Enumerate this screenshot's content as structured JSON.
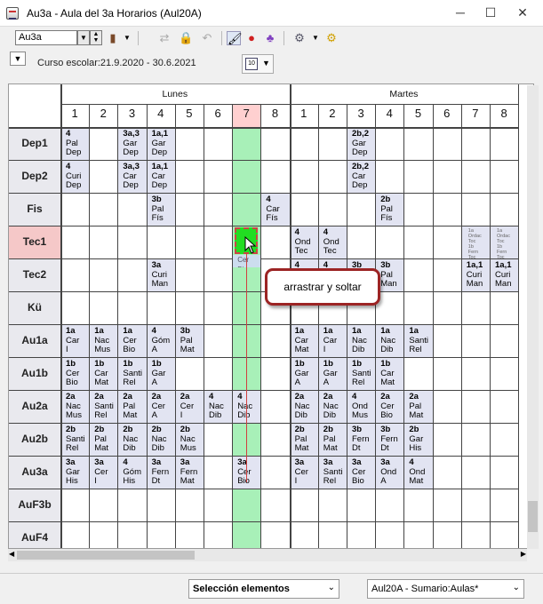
{
  "window": {
    "title": "Au3a - Aula del 3a  Horarios  (Aul20A)",
    "minimize": "─",
    "maximize": "☐",
    "close": "✕"
  },
  "toolbar": {
    "room_combo": "Au3a"
  },
  "subbar": {
    "curso": "Curso escolar:21.9.2020 - 30.6.2021",
    "cal_icon": "10"
  },
  "grid": {
    "days": [
      "Lunes",
      "Martes"
    ],
    "periods": [
      "1",
      "2",
      "3",
      "4",
      "5",
      "6",
      "7",
      "8",
      "1",
      "2",
      "3",
      "4",
      "5",
      "6",
      "7",
      "8"
    ],
    "rows": [
      "Dep1",
      "Dep2",
      "Fis",
      "Tec1",
      "Tec2",
      "Kü",
      "Au1a",
      "Au1b",
      "Au2a",
      "Au2b",
      "Au3a",
      "AuF3b",
      "AuF4"
    ],
    "lessons": [
      {
        "r": 0,
        "c": 0,
        "t": [
          "4",
          "Pal",
          "Dep"
        ]
      },
      {
        "r": 0,
        "c": 2,
        "t": [
          "3a,3",
          "Gar",
          "Dep"
        ]
      },
      {
        "r": 0,
        "c": 3,
        "t": [
          "1a,1",
          "Gar",
          "Dep"
        ]
      },
      {
        "r": 0,
        "c": 10,
        "t": [
          "2b,2",
          "Gar",
          "Dep"
        ]
      },
      {
        "r": 1,
        "c": 0,
        "t": [
          "4",
          "Curi",
          "Dep"
        ]
      },
      {
        "r": 1,
        "c": 2,
        "t": [
          "3a,3",
          "Car",
          "Dep"
        ]
      },
      {
        "r": 1,
        "c": 3,
        "t": [
          "1a,1",
          "Car",
          "Dep"
        ]
      },
      {
        "r": 1,
        "c": 10,
        "t": [
          "2b,2",
          "Car",
          "Dep"
        ]
      },
      {
        "r": 2,
        "c": 3,
        "t": [
          "3b",
          "Pal",
          "Fís"
        ]
      },
      {
        "r": 2,
        "c": 7,
        "t": [
          "4",
          "Car",
          "Fís"
        ]
      },
      {
        "r": 2,
        "c": 11,
        "t": [
          "2b",
          "Pal",
          "Fís"
        ]
      },
      {
        "r": 3,
        "c": 8,
        "t": [
          "4",
          "Ond",
          "Tec"
        ]
      },
      {
        "r": 3,
        "c": 9,
        "t": [
          "4",
          "Ond",
          "Tec"
        ]
      },
      {
        "r": 4,
        "c": 3,
        "t": [
          "3a",
          "Curi",
          "Man"
        ]
      },
      {
        "r": 4,
        "c": 8,
        "t": [
          "4",
          "",
          ""
        ]
      },
      {
        "r": 4,
        "c": 9,
        "t": [
          "4",
          "",
          ""
        ]
      },
      {
        "r": 4,
        "c": 10,
        "t": [
          "3b",
          "",
          ""
        ]
      },
      {
        "r": 4,
        "c": 11,
        "t": [
          "3b",
          "Pal",
          "Man"
        ]
      },
      {
        "r": 4,
        "c": 14,
        "t": [
          "1a,1",
          "Curi",
          "Man"
        ]
      },
      {
        "r": 4,
        "c": 15,
        "t": [
          "1a,1",
          "Curi",
          "Man"
        ]
      },
      {
        "r": 6,
        "c": 0,
        "t": [
          "1a",
          "Car",
          "I"
        ]
      },
      {
        "r": 6,
        "c": 1,
        "t": [
          "1a",
          "Nac",
          "Mus"
        ]
      },
      {
        "r": 6,
        "c": 2,
        "t": [
          "1a",
          "Cer",
          "Bio"
        ]
      },
      {
        "r": 6,
        "c": 3,
        "t": [
          "4",
          "Góm",
          "A"
        ]
      },
      {
        "r": 6,
        "c": 4,
        "t": [
          "3b",
          "Pal",
          "Mat"
        ]
      },
      {
        "r": 6,
        "c": 8,
        "t": [
          "1a",
          "Car",
          "Mat"
        ]
      },
      {
        "r": 6,
        "c": 9,
        "t": [
          "1a",
          "Car",
          "I"
        ]
      },
      {
        "r": 6,
        "c": 10,
        "t": [
          "1a",
          "Nac",
          "Dib"
        ]
      },
      {
        "r": 6,
        "c": 11,
        "t": [
          "1a",
          "Nac",
          "Dib"
        ]
      },
      {
        "r": 6,
        "c": 12,
        "t": [
          "1a",
          "Santi",
          "Rel"
        ]
      },
      {
        "r": 7,
        "c": 0,
        "t": [
          "1b",
          "Cer",
          "Bio"
        ]
      },
      {
        "r": 7,
        "c": 1,
        "t": [
          "1b",
          "Car",
          "Mat"
        ]
      },
      {
        "r": 7,
        "c": 2,
        "t": [
          "1b",
          "Santi",
          "Rel"
        ]
      },
      {
        "r": 7,
        "c": 3,
        "t": [
          "1b",
          "Gar",
          "A"
        ]
      },
      {
        "r": 7,
        "c": 8,
        "t": [
          "1b",
          "Gar",
          "A"
        ]
      },
      {
        "r": 7,
        "c": 9,
        "t": [
          "1b",
          "Gar",
          "A"
        ]
      },
      {
        "r": 7,
        "c": 10,
        "t": [
          "1b",
          "Santi",
          "Rel"
        ]
      },
      {
        "r": 7,
        "c": 11,
        "t": [
          "1b",
          "Car",
          "Mat"
        ]
      },
      {
        "r": 8,
        "c": 0,
        "t": [
          "2a",
          "Nac",
          "Mus"
        ]
      },
      {
        "r": 8,
        "c": 1,
        "t": [
          "2a",
          "Santi",
          "Rel"
        ]
      },
      {
        "r": 8,
        "c": 2,
        "t": [
          "2a",
          "Pal",
          "Mat"
        ]
      },
      {
        "r": 8,
        "c": 3,
        "t": [
          "2a",
          "Cer",
          "A"
        ]
      },
      {
        "r": 8,
        "c": 4,
        "t": [
          "2a",
          "Cer",
          "I"
        ]
      },
      {
        "r": 8,
        "c": 5,
        "t": [
          "4",
          "Nac",
          "Dib"
        ]
      },
      {
        "r": 8,
        "c": 6,
        "t": [
          "4",
          "Nac",
          "Dib"
        ]
      },
      {
        "r": 8,
        "c": 8,
        "t": [
          "2a",
          "Nac",
          "Dib"
        ]
      },
      {
        "r": 8,
        "c": 9,
        "t": [
          "2a",
          "Nac",
          "Dib"
        ]
      },
      {
        "r": 8,
        "c": 10,
        "t": [
          "4",
          "Ond",
          "Mus"
        ]
      },
      {
        "r": 8,
        "c": 11,
        "t": [
          "2a",
          "Cer",
          "Bio"
        ]
      },
      {
        "r": 8,
        "c": 12,
        "t": [
          "2a",
          "Pal",
          "Mat"
        ]
      },
      {
        "r": 9,
        "c": 0,
        "t": [
          "2b",
          "Santi",
          "Rel"
        ]
      },
      {
        "r": 9,
        "c": 1,
        "t": [
          "2b",
          "Pal",
          "Mat"
        ]
      },
      {
        "r": 9,
        "c": 2,
        "t": [
          "2b",
          "Nac",
          "Dib"
        ]
      },
      {
        "r": 9,
        "c": 3,
        "t": [
          "2b",
          "Nac",
          "Dib"
        ]
      },
      {
        "r": 9,
        "c": 4,
        "t": [
          "2b",
          "Nac",
          "Mus"
        ]
      },
      {
        "r": 9,
        "c": 8,
        "t": [
          "2b",
          "Pal",
          "Mat"
        ]
      },
      {
        "r": 9,
        "c": 9,
        "t": [
          "2b",
          "Pal",
          "Mat"
        ]
      },
      {
        "r": 9,
        "c": 10,
        "t": [
          "3b",
          "Fern",
          "Dt"
        ]
      },
      {
        "r": 9,
        "c": 11,
        "t": [
          "3b",
          "Fern",
          "Dt"
        ]
      },
      {
        "r": 9,
        "c": 12,
        "t": [
          "2b",
          "Gar",
          "His"
        ]
      },
      {
        "r": 10,
        "c": 0,
        "t": [
          "3a",
          "Gar",
          "His"
        ]
      },
      {
        "r": 10,
        "c": 1,
        "t": [
          "3a",
          "Cer",
          "I"
        ]
      },
      {
        "r": 10,
        "c": 2,
        "t": [
          "4",
          "Góm",
          "His"
        ]
      },
      {
        "r": 10,
        "c": 3,
        "t": [
          "3a",
          "Fern",
          "Dt"
        ]
      },
      {
        "r": 10,
        "c": 4,
        "t": [
          "3a",
          "Fern",
          "Mat"
        ]
      },
      {
        "r": 10,
        "c": 6,
        "t": [
          "3a",
          "Cer",
          "Bio"
        ]
      },
      {
        "r": 10,
        "c": 8,
        "t": [
          "3a",
          "Cer",
          "I"
        ]
      },
      {
        "r": 10,
        "c": 9,
        "t": [
          "3a",
          "Santi",
          "Rel"
        ]
      },
      {
        "r": 10,
        "c": 10,
        "t": [
          "3a",
          "Cer",
          "Bio"
        ]
      },
      {
        "r": 10,
        "c": 11,
        "t": [
          "3a",
          "Ond",
          "A"
        ]
      },
      {
        "r": 10,
        "c": 12,
        "t": [
          "4",
          "Ond",
          "Mat"
        ]
      }
    ],
    "small_lesson": {
      "r": 3,
      "c": 14,
      "t": [
        "1a",
        "Ordac",
        "Toc",
        "1b",
        "Fern",
        "Toc"
      ]
    },
    "small_lesson2": {
      "r": 3,
      "c": 15,
      "t": [
        "1a",
        "Ordac",
        "Toc",
        "1b",
        "Fern",
        "Toc"
      ]
    },
    "drag_label": [
      "3a",
      "Cer",
      "Bio"
    ]
  },
  "tooltip": {
    "text": "arrastrar y soltar"
  },
  "status": {
    "selector": "Selección elementos",
    "summary": "Aul20A - Sumario:Aulas*"
  },
  "colors": {
    "green_column": "#a8f0b8",
    "lesson_bg": "#e2e4f2",
    "tooltip_border": "#9c2424",
    "highlight_row": "#f5c8c8"
  }
}
